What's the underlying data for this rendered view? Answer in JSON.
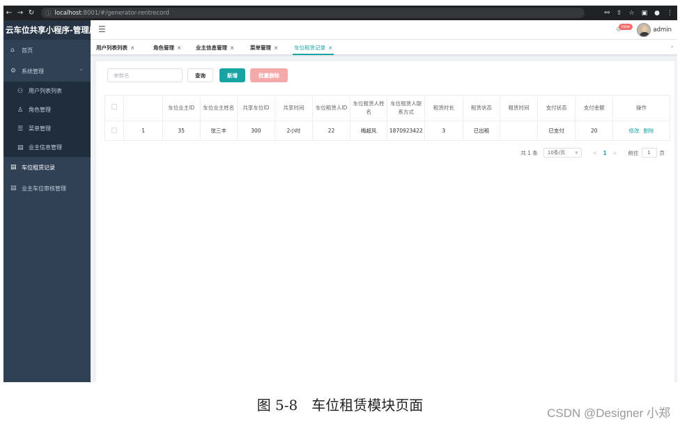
{
  "browser": {
    "url_host": "localhost",
    "url_path": ":8001/#/generator-rentrecord"
  },
  "sidebar": {
    "brand": "云车位共享小程序-管理后",
    "items": [
      {
        "label": "首页",
        "icon": "home-icon"
      },
      {
        "label": "系统管理",
        "icon": "gear-icon",
        "expanded": true
      },
      {
        "label": "用户列表列表",
        "icon": "user-icon",
        "sub": true
      },
      {
        "label": "角色管理",
        "icon": "role-icon",
        "sub": true
      },
      {
        "label": "菜单管理",
        "icon": "menu-list-icon",
        "sub": true
      },
      {
        "label": "业主信息管理",
        "icon": "doc-icon",
        "sub": true
      },
      {
        "label": "车位租赁记录",
        "icon": "doc-icon",
        "active": true
      },
      {
        "label": "业主车位审核管理",
        "icon": "doc-icon"
      }
    ]
  },
  "header": {
    "badge": "new",
    "username": "admin"
  },
  "tags": [
    {
      "label": "用户列表列表",
      "close": "×"
    },
    {
      "label": "角色管理",
      "close": "×"
    },
    {
      "label": "业主信息管理",
      "close": "×"
    },
    {
      "label": "菜单管理",
      "close": "×"
    },
    {
      "label": "车位租赁记录",
      "close": "×",
      "active": true
    }
  ],
  "toolbar": {
    "search_placeholder": "参数名",
    "query_label": "查询",
    "add_label": "新增",
    "batch_delete_label": "批量删除"
  },
  "table": {
    "columns": [
      "",
      "",
      "车位业主ID",
      "车位业主姓名",
      "共享车位ID",
      "共享时间",
      "车位租赁人ID",
      "车位租赁人姓名",
      "车位租赁人联系方式",
      "租赁时长",
      "租赁状态",
      "租赁时间",
      "支付状态",
      "支付金额",
      "操作"
    ],
    "rows": [
      {
        "index": "1",
        "owner_id": "35",
        "owner_name": "张三丰",
        "space_id": "300",
        "share_time": "2小时",
        "renter_id": "22",
        "renter_name": "梅超风",
        "renter_phone": "1870923422",
        "rent_duration": "3",
        "rent_status": "已出租",
        "rent_time": "",
        "pay_status": "已支付",
        "pay_amount": "20",
        "op_edit": "修改",
        "op_delete": "删除"
      }
    ]
  },
  "pagination": {
    "total": "共 1 条",
    "page_size": "10条/页",
    "prev": "<",
    "current": "1",
    "next": ">",
    "goto_label": "前往",
    "goto_value": "1",
    "goto_suffix": "页"
  },
  "caption": "图 5-8　车位租赁模块页面",
  "watermark": "CSDN @Designer 小郑",
  "colors": {
    "sidebar_bg": "#304156",
    "accent": "#1aa3a3",
    "danger_light": "#f5a9a9"
  }
}
